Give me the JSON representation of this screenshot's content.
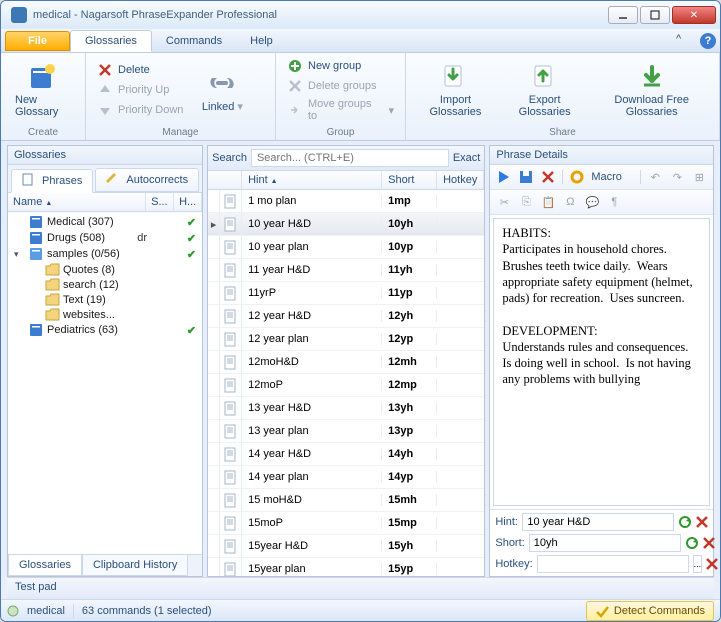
{
  "window": {
    "title": "medical - Nagarsoft PhraseExpander Professional"
  },
  "menubar": {
    "file": "File",
    "tabs": [
      "Glossaries",
      "Commands",
      "Help"
    ],
    "active": 0
  },
  "ribbon": {
    "create": {
      "label": "Create",
      "new_glossary": "New Glossary"
    },
    "manage": {
      "label": "Manage",
      "delete": "Delete",
      "priority_up": "Priority Up",
      "priority_down": "Priority Down",
      "linked": "Linked"
    },
    "group": {
      "label": "Group",
      "new_group": "New group",
      "delete_groups": "Delete groups",
      "move_groups_to": "Move groups to"
    },
    "share": {
      "label": "Share",
      "import": "Import Glossaries",
      "export": "Export Glossaries",
      "download": "Download Free Glossaries"
    }
  },
  "left": {
    "panel_title": "Glossaries",
    "tab_phrases": "Phrases",
    "tab_autocorrects": "Autocorrects",
    "columns": {
      "name": "Name",
      "s": "S...",
      "h": "H..."
    },
    "tree": [
      {
        "indent": 1,
        "icon": "book",
        "label": "Medical (307)",
        "check": true
      },
      {
        "indent": 1,
        "icon": "book",
        "label": "Drugs (508)",
        "extra": "dr",
        "check": true
      },
      {
        "indent": 0,
        "icon": "twisty-open",
        "label": ""
      },
      {
        "indent": 1,
        "icon": "book2",
        "label": "samples (0/56)",
        "check": true,
        "child_of_open": true
      },
      {
        "indent": 2,
        "icon": "folder",
        "label": "Quotes (8)"
      },
      {
        "indent": 2,
        "icon": "folder",
        "label": "search (12)"
      },
      {
        "indent": 2,
        "icon": "folder",
        "label": "Text (19)"
      },
      {
        "indent": 2,
        "icon": "folder",
        "label": "websites..."
      },
      {
        "indent": 1,
        "icon": "book",
        "label": "Pediatrics (63)",
        "check": true
      }
    ],
    "bottom_tabs": {
      "glossaries": "Glossaries",
      "clipboard": "Clipboard History"
    }
  },
  "mid": {
    "search_label": "Search",
    "search_placeholder": "Search... (CTRL+E)",
    "exact_label": "Exact",
    "columns": {
      "hint": "Hint",
      "short": "Short",
      "hotkey": "Hotkey"
    },
    "rows": [
      {
        "hint": "1 mo plan",
        "short": "1mp"
      },
      {
        "hint": "10 year H&D",
        "short": "10yh",
        "selected": true
      },
      {
        "hint": "10 year plan",
        "short": "10yp"
      },
      {
        "hint": "11 year H&D",
        "short": "11yh"
      },
      {
        "hint": "11yrP",
        "short": "11yp"
      },
      {
        "hint": "12 year H&D",
        "short": "12yh"
      },
      {
        "hint": "12 year plan",
        "short": "12yp"
      },
      {
        "hint": "12moH&D",
        "short": "12mh"
      },
      {
        "hint": "12moP",
        "short": "12mp"
      },
      {
        "hint": "13 year H&D",
        "short": "13yh"
      },
      {
        "hint": "13 year plan",
        "short": "13yp"
      },
      {
        "hint": "14 year H&D",
        "short": "14yh"
      },
      {
        "hint": "14 year plan",
        "short": "14yp"
      },
      {
        "hint": "15 moH&D",
        "short": "15mh"
      },
      {
        "hint": "15moP",
        "short": "15mp"
      },
      {
        "hint": "15year H&D",
        "short": "15yh"
      },
      {
        "hint": "15year plan",
        "short": "15yp"
      }
    ]
  },
  "right": {
    "panel_title": "Phrase Details",
    "macro_label": "Macro",
    "preview_html": "HABITS:<br>Participates in household chores.&nbsp; Brushes teeth twice daily.&nbsp; Wears appropriate safety equipment (helmet, pads) for recreation.&nbsp; Uses suncreen.<br><br>DEVELOPMENT:<br>Understands rules and consequences.&nbsp; Is doing well in school.&nbsp; Is not having any problems with bullying",
    "fields": {
      "hint_label": "Hint:",
      "hint_value": "10 year H&D",
      "short_label": "Short:",
      "short_value": "10yh",
      "hotkey_label": "Hotkey:",
      "hotkey_value": ""
    }
  },
  "bottom": {
    "testpad": "Test pad"
  },
  "status": {
    "glossary": "medical",
    "commands": "63 commands (1 selected)",
    "detect": "Detect Commands"
  }
}
